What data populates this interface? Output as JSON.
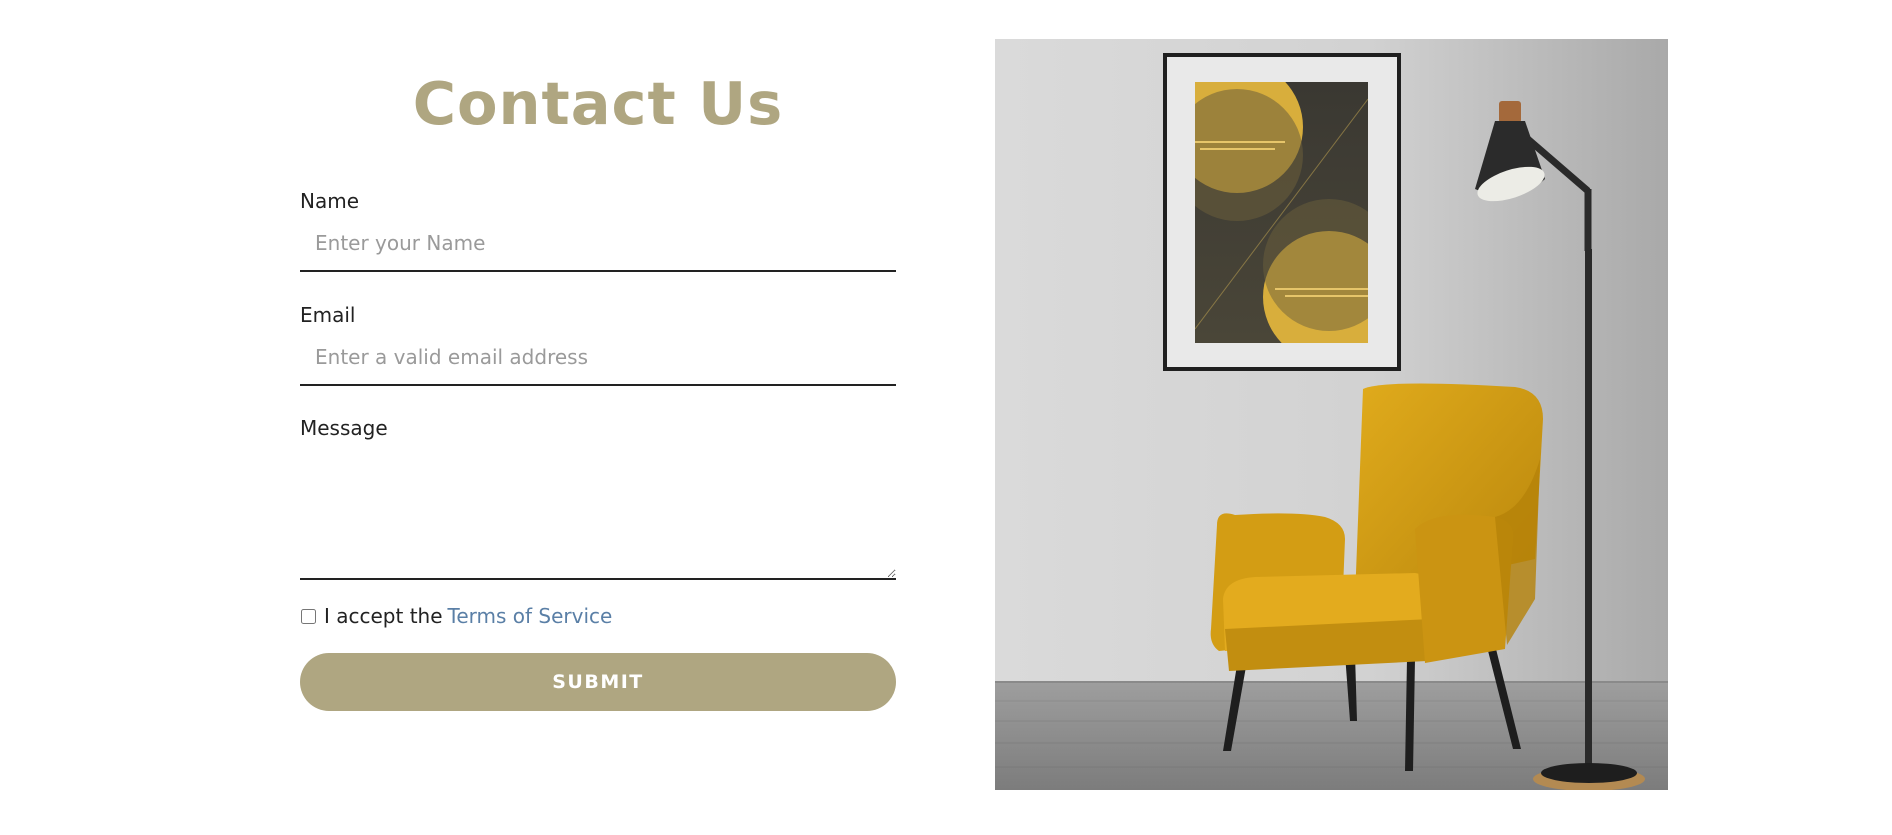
{
  "form": {
    "title": "Contact Us",
    "name_label": "Name",
    "name_placeholder": "Enter your Name",
    "name_value": "",
    "email_label": "Email",
    "email_placeholder": "Enter a valid email address",
    "email_value": "",
    "message_label": "Message",
    "message_value": "",
    "terms_prefix": "I accept the",
    "terms_link": "Terms of Service",
    "terms_checked": false,
    "submit_label": "SUBMIT"
  },
  "photo": {
    "subject": "yellow velvet armchair, framed abstract art print and black floor lamp against a grey wall"
  },
  "colors": {
    "accent": "#afa681",
    "text": "#222222",
    "placeholder": "#9a9a9a",
    "link": "#5a7fa6",
    "button_text": "#ffffff",
    "background": "#ffffff",
    "chair": "#d9a214",
    "wall": "#cfcfcf"
  }
}
